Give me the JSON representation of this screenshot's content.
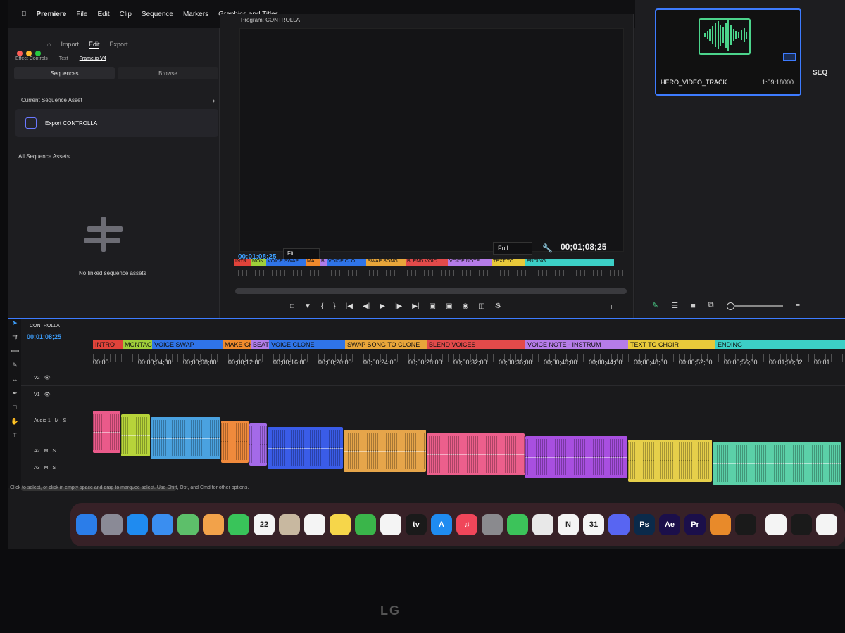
{
  "menubar": {
    "items": [
      "Premiere",
      "File",
      "Edit",
      "Clip",
      "Sequence",
      "Markers",
      "Graphics and Titles"
    ]
  },
  "left_panel": {
    "nav": [
      "Import",
      "Edit",
      "Export"
    ],
    "tabs": [
      "Effect Controls",
      "Text",
      "Frame.io V4"
    ],
    "segments": [
      "Sequences",
      "Browse"
    ],
    "current_label": "Current Sequence Asset",
    "export_label": "Export CONTROLLA",
    "all_label": "All Sequence Assets",
    "empty_label": "No linked sequence assets"
  },
  "program": {
    "title": "Program: CONTROLLA",
    "timecode_left": "00;01;08;25",
    "fit": "Fit",
    "quality": "Full",
    "timecode_right": "00;01;08;25"
  },
  "project": {
    "clip_name": "HERO_VIDEO_TRACK...",
    "duration": "1:09:18000",
    "seq_label": "SEQ"
  },
  "timeline": {
    "sequence_name": "CONTROLLA",
    "timecode": "00;01;08;25",
    "ruler": [
      "00;00",
      "00;00;04;00",
      "00;00;08;00",
      "00;00;12;00",
      "00;00;16;00",
      "00;00;20;00",
      "00;00;24;00",
      "00;00;28;00",
      "00;00;32;00",
      "00;00;36;00",
      "00;00;40;00",
      "00;00;44;00",
      "00;00;48;00",
      "00;00;52;00",
      "00;00;56;00",
      "00;01;00;02",
      "00;01"
    ],
    "tracks": [
      "V2",
      "V1",
      "Audio 1",
      "A2",
      "A3"
    ],
    "markers": [
      {
        "label": "INTRO",
        "color": "#e0433a"
      },
      {
        "label": "MONTAGE",
        "color": "#9fcf3a"
      },
      {
        "label": "VOICE SWAP",
        "color": "#2f74e8"
      },
      {
        "label": "MAKE CH",
        "color": "#f08a2c"
      },
      {
        "label": "BEAT",
        "color": "#b07de8"
      },
      {
        "label": "VOICE CLONE",
        "color": "#2f74e8"
      },
      {
        "label": "SWAP SONG TO CLONE",
        "color": "#e8a63a"
      },
      {
        "label": "BLEND VOICES",
        "color": "#e24a4a"
      },
      {
        "label": "VOICE NOTE - INSTRUM",
        "color": "#b57ce8"
      },
      {
        "label": "TEXT TO CHOIR",
        "color": "#e8c93a"
      },
      {
        "label": "ENDING",
        "color": "#3ccfc6"
      }
    ],
    "program_markers": [
      "INTR",
      "MON",
      "VOICE SWAP",
      "MA",
      "B",
      "VOICE CLO",
      "SWAP SONG",
      "BLEND VOIC",
      "VOICE NOTE",
      "TEXT TO",
      "ENDING"
    ],
    "clips": [
      {
        "color": "#ea5a8a"
      },
      {
        "color": "#b7d43a"
      },
      {
        "color": "#4aa2e0"
      },
      {
        "color": "#f08a3c"
      },
      {
        "color": "#a46ae8"
      },
      {
        "color": "#3a5ce8"
      },
      {
        "color": "#e6a54a"
      },
      {
        "color": "#ec5f8c"
      },
      {
        "color": "#a84fe0"
      },
      {
        "color": "#e6cf4a"
      },
      {
        "color": "#5bd0a8"
      }
    ],
    "status": "Click to select, or click in empty space and drag to marquee select. Use Shift, Opt, and Cmd for other options."
  },
  "dock": {
    "apps": [
      {
        "name": "finder",
        "label": "",
        "color": "#2b7de9"
      },
      {
        "name": "launchpad",
        "label": "",
        "color": "#8a8a96"
      },
      {
        "name": "safari",
        "label": "",
        "color": "#1f8bf0"
      },
      {
        "name": "mail",
        "label": "",
        "color": "#3a8ef0"
      },
      {
        "name": "maps",
        "label": "",
        "color": "#5dbf6a"
      },
      {
        "name": "photos",
        "label": "",
        "color": "#f2a24a"
      },
      {
        "name": "facetime",
        "label": "",
        "color": "#39c45a"
      },
      {
        "name": "calendar",
        "label": "22",
        "color": "#f4f4f4"
      },
      {
        "name": "contacts",
        "label": "",
        "color": "#c8b8a0"
      },
      {
        "name": "reminders",
        "label": "",
        "color": "#f4f4f4"
      },
      {
        "name": "notes",
        "label": "",
        "color": "#f6d64a"
      },
      {
        "name": "numbers",
        "label": "",
        "color": "#3ab54a"
      },
      {
        "name": "freeform",
        "label": "",
        "color": "#f4f4f4"
      },
      {
        "name": "apple-tv",
        "label": "tv",
        "color": "#1a1a1a"
      },
      {
        "name": "app-store",
        "label": "A",
        "color": "#1f8bf0"
      },
      {
        "name": "music",
        "label": "♫",
        "color": "#f0465a"
      },
      {
        "name": "system-settings",
        "label": "",
        "color": "#8a8a8e"
      },
      {
        "name": "whatsapp",
        "label": "",
        "color": "#3cc35a"
      },
      {
        "name": "chrome",
        "label": "",
        "color": "#e8e8e8"
      },
      {
        "name": "notion",
        "label": "N",
        "color": "#f4f4f4"
      },
      {
        "name": "calendar-31",
        "label": "31",
        "color": "#f4f4f4"
      },
      {
        "name": "discord",
        "label": "",
        "color": "#5865f2"
      },
      {
        "name": "photoshop",
        "label": "Ps",
        "color": "#0b2a4a"
      },
      {
        "name": "after-effects",
        "label": "Ae",
        "color": "#1b0f4a"
      },
      {
        "name": "premiere",
        "label": "Pr",
        "color": "#1b0f4a"
      },
      {
        "name": "blender",
        "label": "",
        "color": "#e88a2a"
      },
      {
        "name": "figma",
        "label": "",
        "color": "#1a1a1a"
      },
      {
        "name": "slack",
        "label": "",
        "color": "#f4f4f4"
      },
      {
        "name": "capcut",
        "label": "",
        "color": "#1a1a1a"
      },
      {
        "name": "quicktime",
        "label": "",
        "color": "#f4f4f4"
      }
    ]
  },
  "monitor_brand": "LG"
}
